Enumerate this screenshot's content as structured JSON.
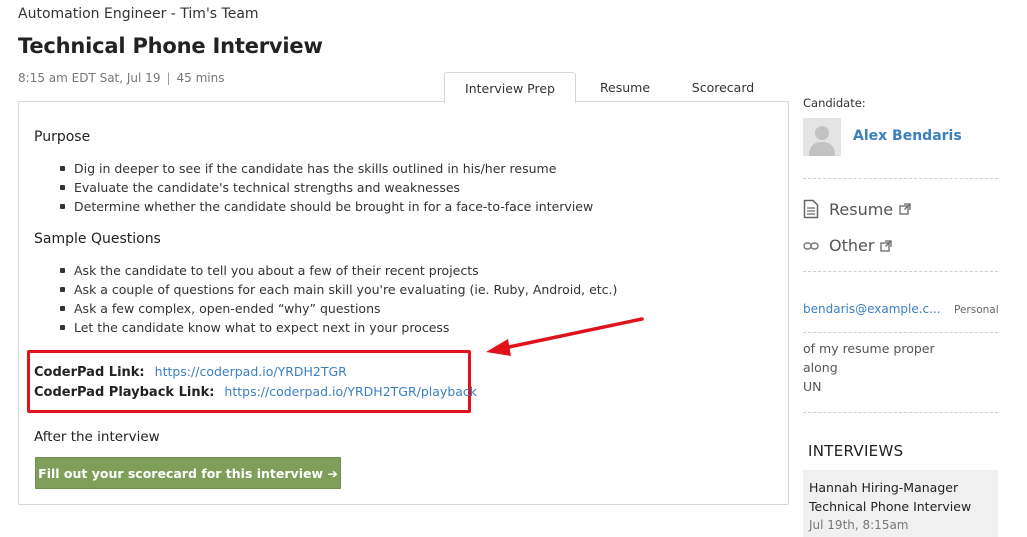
{
  "header": {
    "job_line": "Automation Engineer - Tim's Team",
    "title": "Technical Phone Interview",
    "time": "8:15 am EDT Sat, Jul 19",
    "separator": "|",
    "duration": "45 mins"
  },
  "tabs": [
    {
      "label": "Interview Prep",
      "active": true
    },
    {
      "label": "Resume",
      "active": false
    },
    {
      "label": "Scorecard",
      "active": false
    }
  ],
  "prep": {
    "purpose_heading": "Purpose",
    "purpose_items": [
      "Dig in deeper to see if the candidate has the skills outlined in his/her resume",
      "Evaluate the candidate's technical strengths and weaknesses",
      "Determine whether the candidate should be brought in for a face-to-face interview"
    ],
    "questions_heading": "Sample Questions",
    "question_items": [
      "Ask the candidate to tell you about a few of their recent projects",
      "Ask a couple of questions for each main skill you're evaluating (ie. Ruby, Android, etc.)",
      "Ask a few complex, open-ended “why” questions",
      "Let the candidate know what to expect next in your process"
    ],
    "coderpad_label": "CoderPad Link:",
    "coderpad_url": "https://coderpad.io/YRDH2TGR",
    "playback_label": "CoderPad Playback Link:",
    "playback_url": "https://coderpad.io/YRDH2TGR/playback",
    "after_label": "After the interview",
    "scorecard_button": "Fill out your scorecard for this interview ➔"
  },
  "sidebar": {
    "candidate_label": "Candidate:",
    "candidate_name": "Alex Bendaris",
    "docs": [
      {
        "label": "Resume",
        "icon": "document-icon"
      },
      {
        "label": "Other",
        "icon": "link-icon"
      }
    ],
    "email": "bendaris@example.c...",
    "email_type": "Personal",
    "notes": [
      "of my resume proper",
      "along",
      "UN"
    ],
    "interviews_heading": "INTERVIEWS",
    "interview": {
      "interviewer": "Hannah Hiring-Manager",
      "type": "Technical Phone Interview",
      "date": "Jul 19th, 8:15am"
    }
  },
  "colors": {
    "link": "#3c7fc0",
    "button": "#7e9f5a",
    "highlight": "#e0121b"
  }
}
